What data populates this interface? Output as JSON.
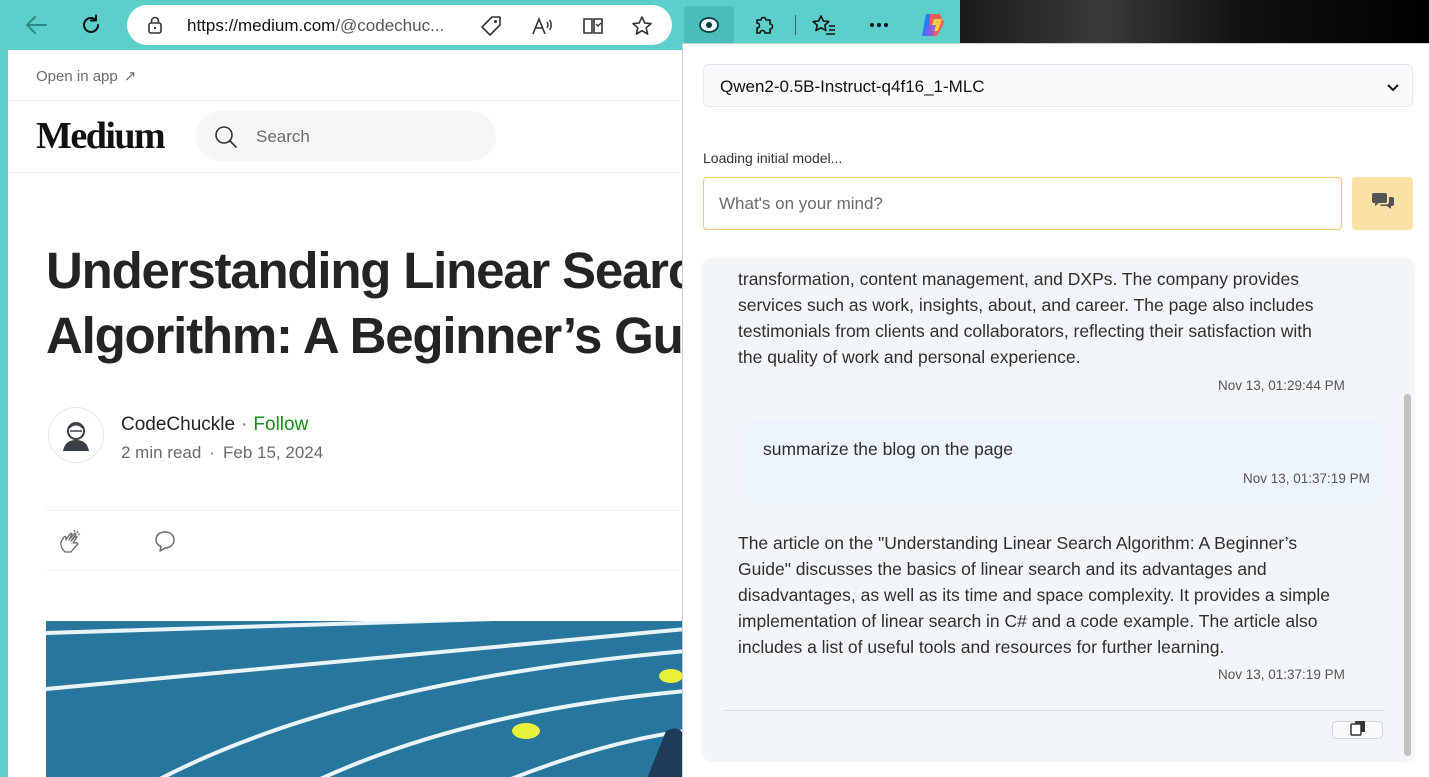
{
  "browser": {
    "url_host": "https://medium.com",
    "url_path": "/@codechuc...",
    "icons": [
      "back-icon",
      "refresh-icon",
      "lock-icon",
      "tag-icon",
      "read-aloud-icon",
      "immersive-reader-icon",
      "favorite-star-icon",
      "extension-eye-icon",
      "extensions-puzzle-icon",
      "favorites-icon",
      "more-icon",
      "copilot-icon"
    ]
  },
  "medium": {
    "open_in_app": "Open in app",
    "open_in_app_arrow": "↗",
    "logo": "Medium",
    "search_placeholder": "Search",
    "title_line1": "Understanding Linear Search",
    "title_line2": "Algorithm: A Beginner’s Guide",
    "author": "CodeChuckle",
    "separator": "·",
    "follow": "Follow",
    "read_time": "2 min read",
    "date": "Feb 15, 2024",
    "colors": {
      "follow": "#1a8917",
      "text": "#242424"
    }
  },
  "panel": {
    "model": "Qwen2-0.5B-Instruct-q4f16_1-MLC",
    "status": "Loading initial model...",
    "input_placeholder": "What's on your mind?",
    "messages": [
      {
        "role": "assistant",
        "lines": [
          "transformation, content management, and DXPs. The company provides",
          "services such as work, insights, about, and career. The page also includes",
          "testimonials from clients and collaborators, reflecting their satisfaction with",
          "the quality of work and personal experience."
        ],
        "time": "Nov 13, 01:29:44 PM"
      },
      {
        "role": "user",
        "text": "summarize the blog on the page",
        "time": "Nov 13, 01:37:19 PM"
      },
      {
        "role": "assistant",
        "lines": [
          "The article on the \"Understanding Linear Search Algorithm: A Beginner’s",
          "Guide\" discusses the basics of linear search and its advantages and",
          "disadvantages, as well as its time and space complexity. It provides a simple",
          "implementation of linear search in C# and a code example. The article also",
          "includes a list of useful tools and resources for further learning."
        ],
        "time": "Nov 13, 01:37:19 PM"
      }
    ],
    "colors": {
      "input_border": "#f7c873",
      "send_bg": "#fbe1a6",
      "chat_bg": "#f3f6f9"
    }
  }
}
